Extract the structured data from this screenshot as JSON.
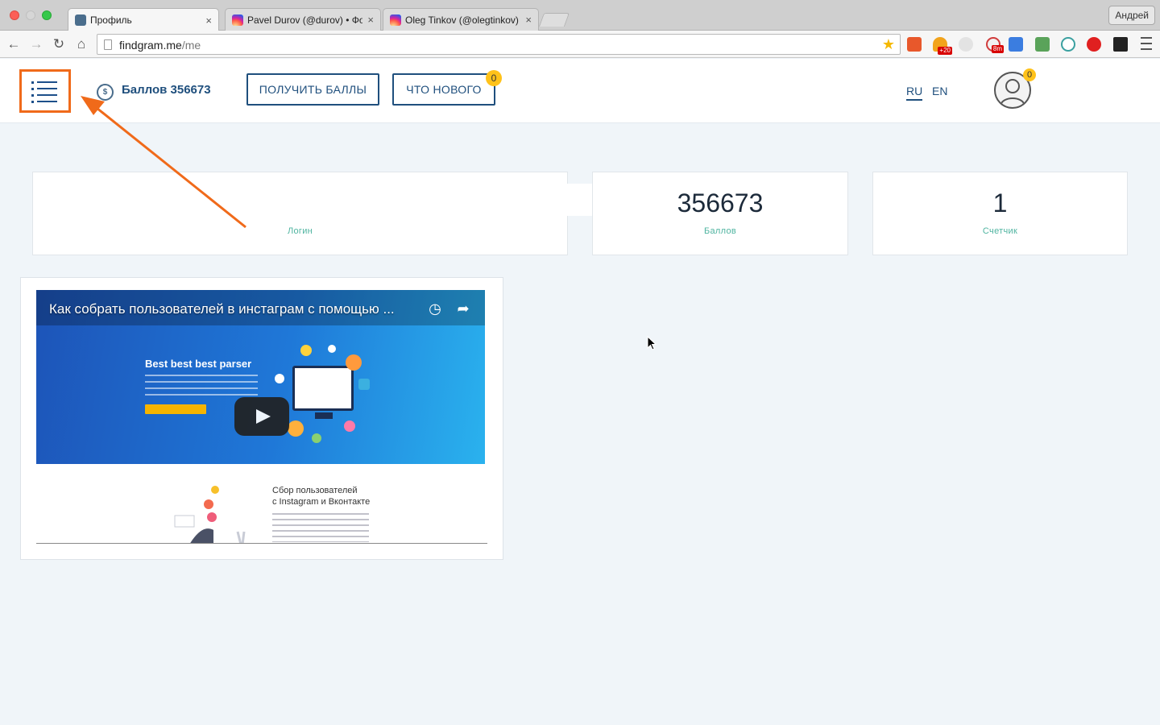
{
  "browser": {
    "tabs": [
      {
        "title": "Профиль",
        "favicon": "findgram-icon",
        "active": true
      },
      {
        "title": "Pavel Durov (@durov) • Фо",
        "favicon": "instagram-icon",
        "active": false
      },
      {
        "title": "Oleg Tinkov (@olegtinkov)",
        "favicon": "instagram-icon",
        "active": false
      }
    ],
    "user_name": "Андрей",
    "url_host": "findgram.me",
    "url_path": "/me",
    "extension_badges": {
      "counter": "+20",
      "timer": "8m"
    }
  },
  "header": {
    "balance_label": "Баллов 356673",
    "get_points_button": "ПОЛУЧИТЬ БАЛЛЫ",
    "whats_new_button": "ЧТО НОВОГО",
    "whats_new_badge": "0",
    "avatar_badge": "0",
    "languages": [
      "RU",
      "EN"
    ],
    "active_language": "RU",
    "accent_color": "#1f4f7d",
    "highlight_color": "#f06a1a"
  },
  "stats": [
    {
      "value": "",
      "label": "Логин"
    },
    {
      "value": "356673",
      "label": "Баллов"
    },
    {
      "value": "1",
      "label": "Счетчик"
    }
  ],
  "video": {
    "title": "Как собрать пользователей в инстаграм с помощью ...",
    "hero_heading": "Best best best parser",
    "lower_title_line1": "Сбор пользователей",
    "lower_title_line2": "с Instagram и Вконтакте"
  }
}
